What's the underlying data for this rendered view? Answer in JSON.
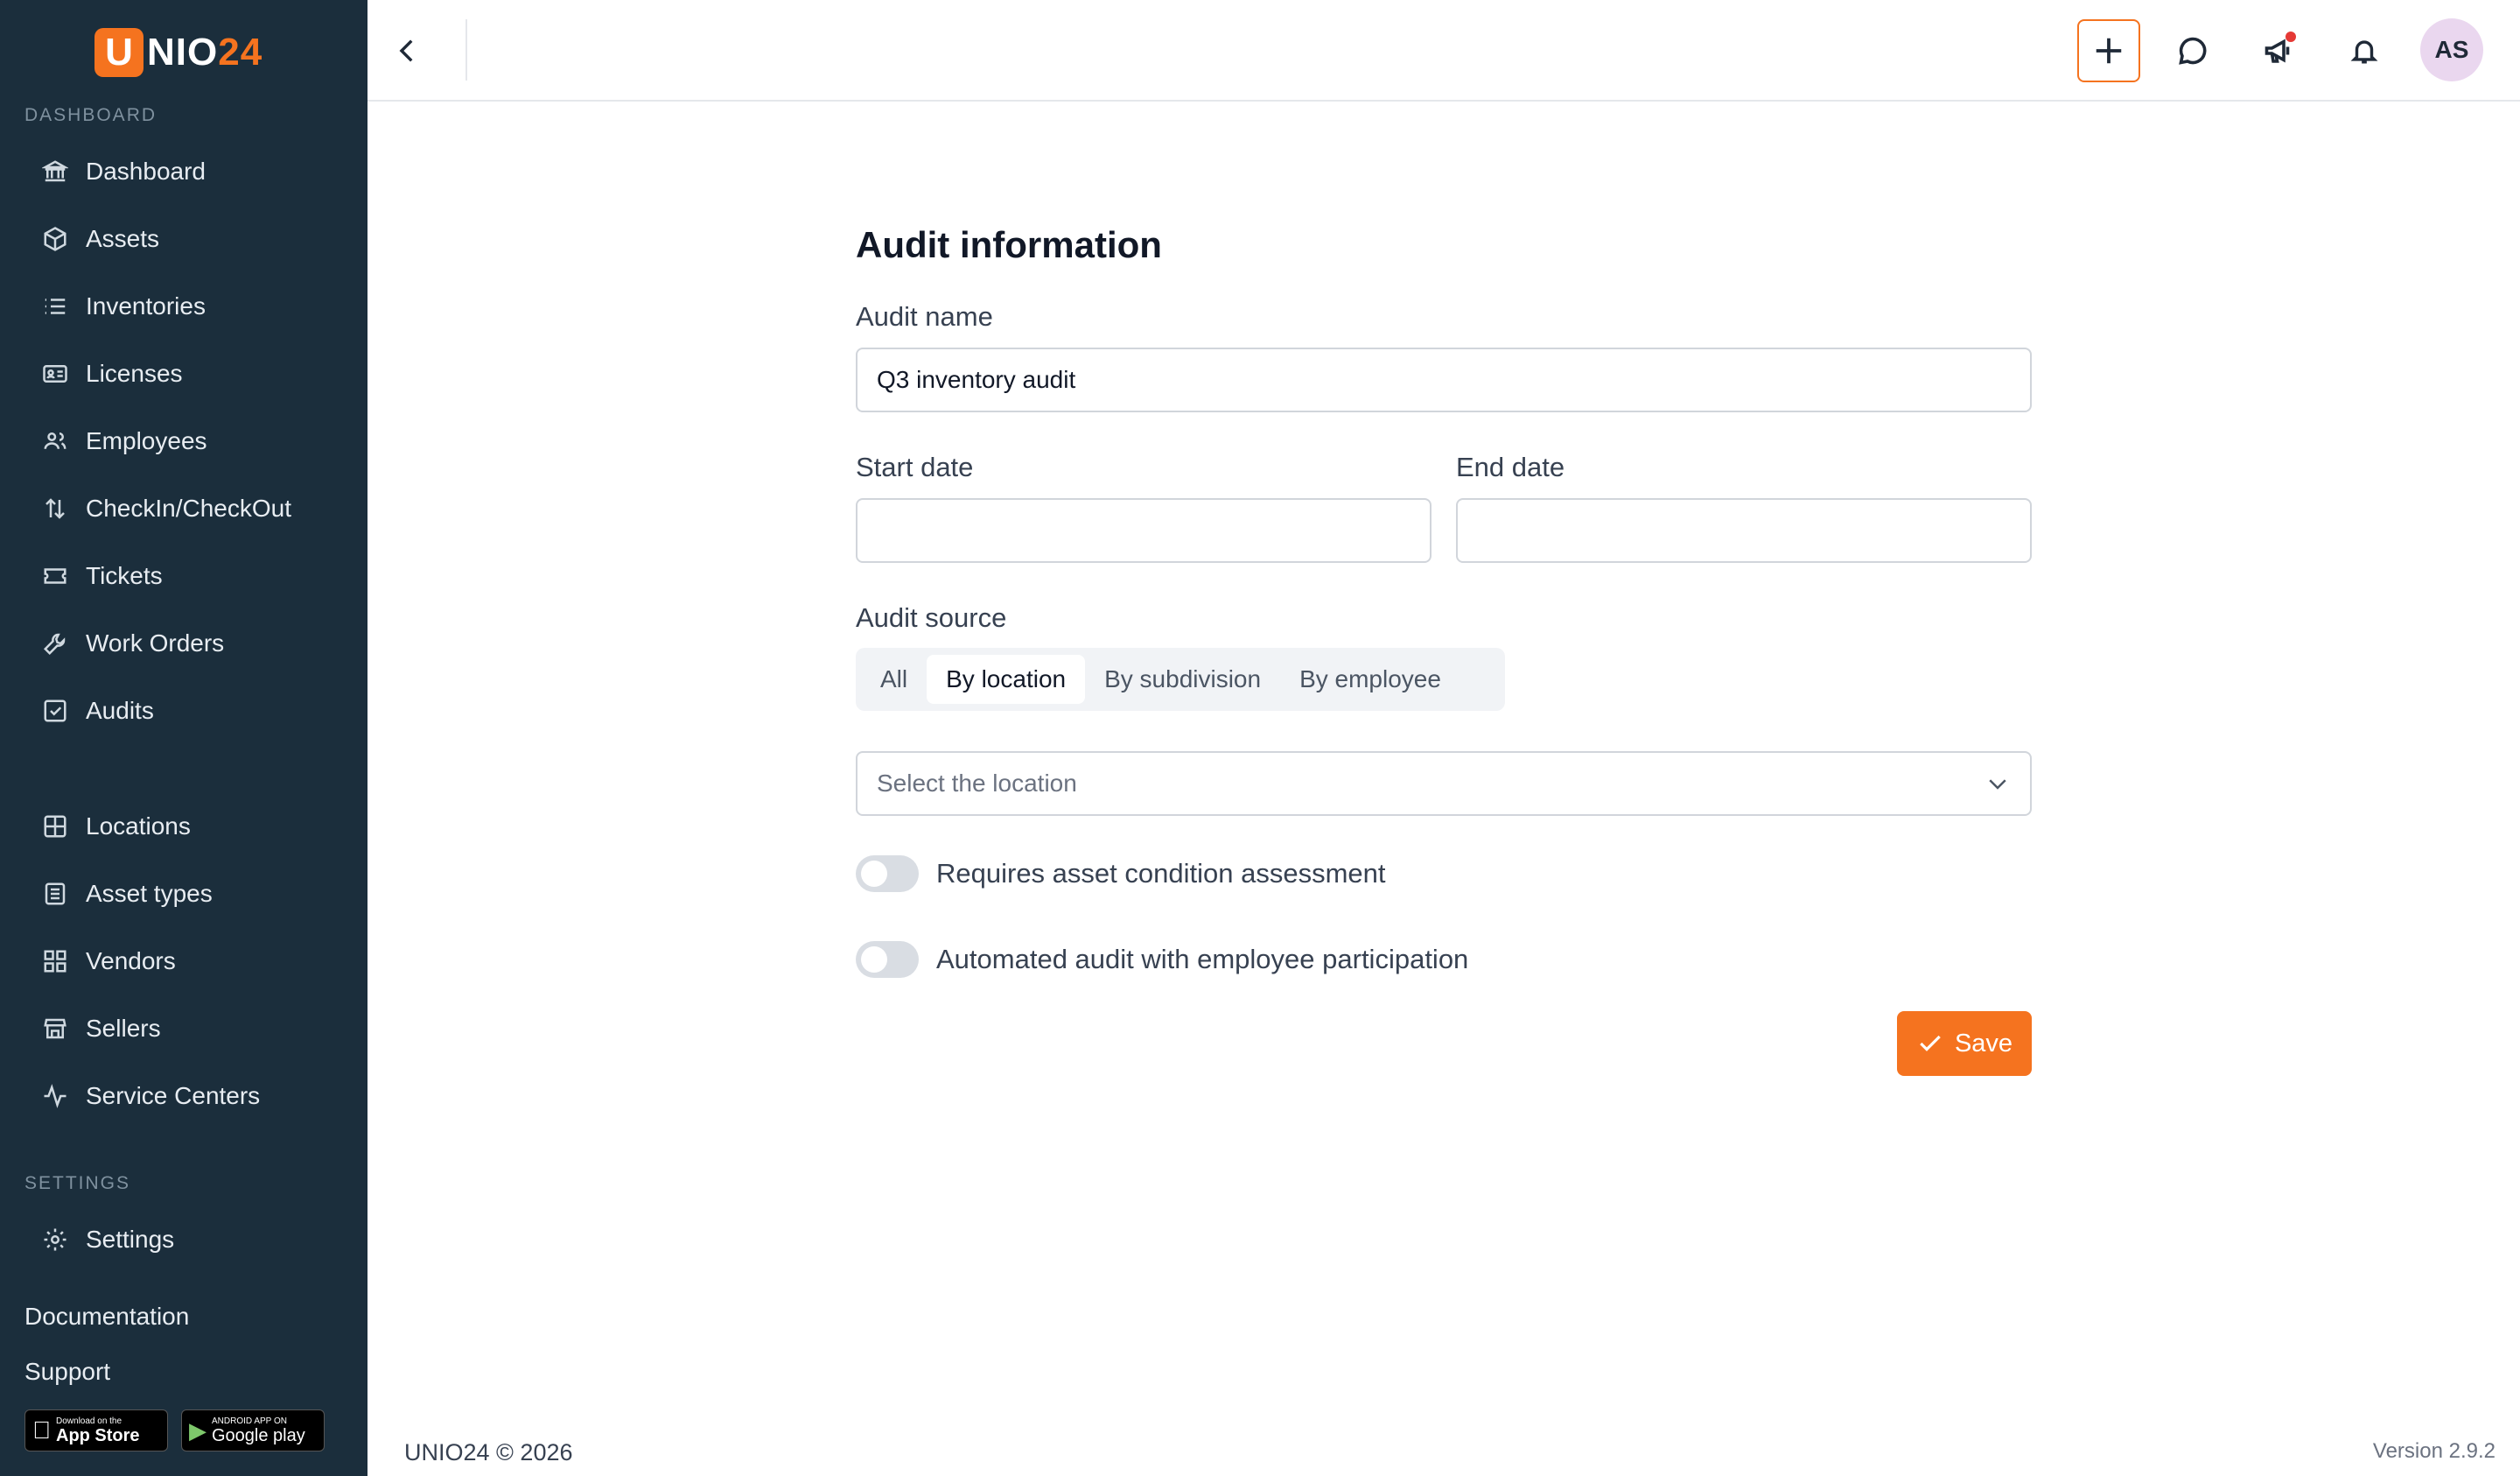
{
  "brand": {
    "logo_u": "U",
    "logo_text": "NIO",
    "logo_num": "24",
    "accent": "#f5731f",
    "sidebar_bg": "#1b2e3c"
  },
  "sidebar": {
    "section_dashboard": "DASHBOARD",
    "main_items": [
      {
        "label": "Dashboard",
        "icon": "bank-icon"
      },
      {
        "label": "Assets",
        "icon": "cube-icon"
      },
      {
        "label": "Inventories",
        "icon": "list-icon"
      },
      {
        "label": "Licenses",
        "icon": "id-card-icon"
      },
      {
        "label": "Employees",
        "icon": "users-icon"
      },
      {
        "label": "CheckIn/CheckOut",
        "icon": "arrows-updown-icon"
      },
      {
        "label": "Tickets",
        "icon": "ticket-icon"
      },
      {
        "label": "Work Orders",
        "icon": "wrench-icon"
      },
      {
        "label": "Audits",
        "icon": "checkbox-icon"
      }
    ],
    "secondary_items": [
      {
        "label": "Locations",
        "icon": "grid-icon"
      },
      {
        "label": "Asset types",
        "icon": "document-icon"
      },
      {
        "label": "Vendors",
        "icon": "apps-icon"
      },
      {
        "label": "Sellers",
        "icon": "store-icon"
      },
      {
        "label": "Service Centers",
        "icon": "activity-icon"
      }
    ],
    "section_settings": "SETTINGS",
    "settings_item": {
      "label": "Settings",
      "icon": "gear-icon"
    },
    "documentation": "Documentation",
    "support": "Support",
    "app_store": {
      "small": "Download on the",
      "big": "App Store"
    },
    "google_play": {
      "small": "ANDROID APP ON",
      "big": "Google play"
    }
  },
  "topbar": {
    "avatar_initials": "AS"
  },
  "form": {
    "title": "Audit information",
    "audit_name_label": "Audit name",
    "audit_name_value": "Q3 inventory audit",
    "start_date_label": "Start date",
    "start_date_value": "",
    "end_date_label": "End date",
    "end_date_value": "",
    "audit_source_label": "Audit source",
    "source_options": [
      "All",
      "By location",
      "By subdivision",
      "By employee"
    ],
    "source_selected": "By location",
    "location_placeholder": "Select the location",
    "toggle_condition_label": "Requires asset condition assessment",
    "toggle_condition_on": false,
    "toggle_automated_label": "Automated audit with employee participation",
    "toggle_automated_on": false,
    "save_label": "Save"
  },
  "footer": {
    "copyright": "UNIO24 © 2026",
    "version": "Version 2.9.2"
  }
}
